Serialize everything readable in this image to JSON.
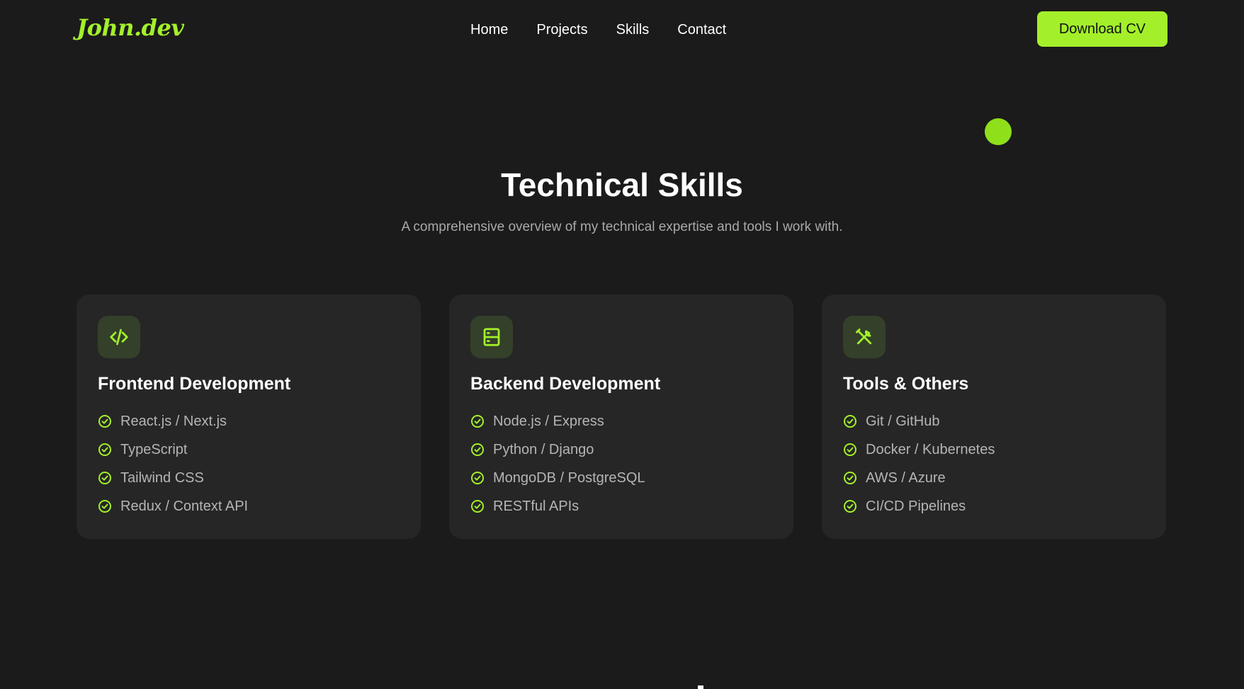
{
  "header": {
    "logo": "John.dev",
    "nav": [
      "Home",
      "Projects",
      "Skills",
      "Contact"
    ],
    "cta_label": "Download CV"
  },
  "section": {
    "title": "Technical Skills",
    "subtitle": "A comprehensive overview of my technical expertise and tools I work with."
  },
  "cards": [
    {
      "icon": "code-icon",
      "title": "Frontend Development",
      "skills": [
        "React.js / Next.js",
        "TypeScript",
        "Tailwind CSS",
        "Redux / Context API"
      ]
    },
    {
      "icon": "server-icon",
      "title": "Backend Development",
      "skills": [
        "Node.js / Express",
        "Python / Django",
        "MongoDB / PostgreSQL",
        "RESTful APIs"
      ]
    },
    {
      "icon": "tools-icon",
      "title": "Tools & Others",
      "skills": [
        "Git / GitHub",
        "Docker / Kubernetes",
        "AWS / Azure",
        "CI/CD Pipelines"
      ]
    }
  ],
  "colors": {
    "accent": "#a3f02a",
    "background": "#1b1b1b",
    "card": "#262626",
    "muted_text": "#b5b5b5"
  }
}
